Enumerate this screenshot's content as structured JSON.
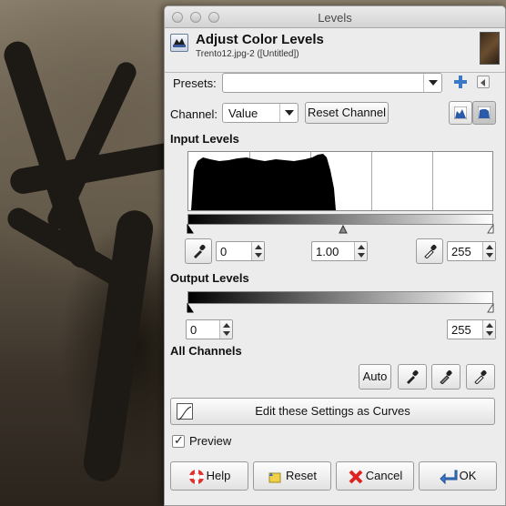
{
  "window": {
    "title": "Levels"
  },
  "header": {
    "title": "Adjust Color Levels",
    "subtitle": "Trento12.jpg-2 ([Untitled])"
  },
  "presets": {
    "label": "Presets:",
    "value": ""
  },
  "channel": {
    "label": "Channel:",
    "value": "Value",
    "reset_label": "Reset Channel"
  },
  "input_levels": {
    "title": "Input Levels",
    "black": "0",
    "gamma": "1.00",
    "white": "255",
    "gamma_position": 0.5
  },
  "output_levels": {
    "title": "Output Levels",
    "low": "0",
    "high": "255"
  },
  "all_channels": {
    "title": "All Channels",
    "auto_label": "Auto"
  },
  "curves_button": {
    "label": "Edit these Settings as Curves"
  },
  "preview": {
    "label": "Preview",
    "checked": true
  },
  "footer": {
    "help": "Help",
    "reset": "Reset",
    "cancel": "Cancel",
    "ok": "OK"
  },
  "icons": {
    "add_preset": "plus-icon",
    "preset_menu": "menu-arrow-icon",
    "linear_hist": "linear-histogram-icon",
    "log_hist": "log-histogram-icon",
    "black_picker": "black-eyedropper-icon",
    "gray_picker": "gray-eyedropper-icon",
    "white_picker": "white-eyedropper-icon"
  }
}
